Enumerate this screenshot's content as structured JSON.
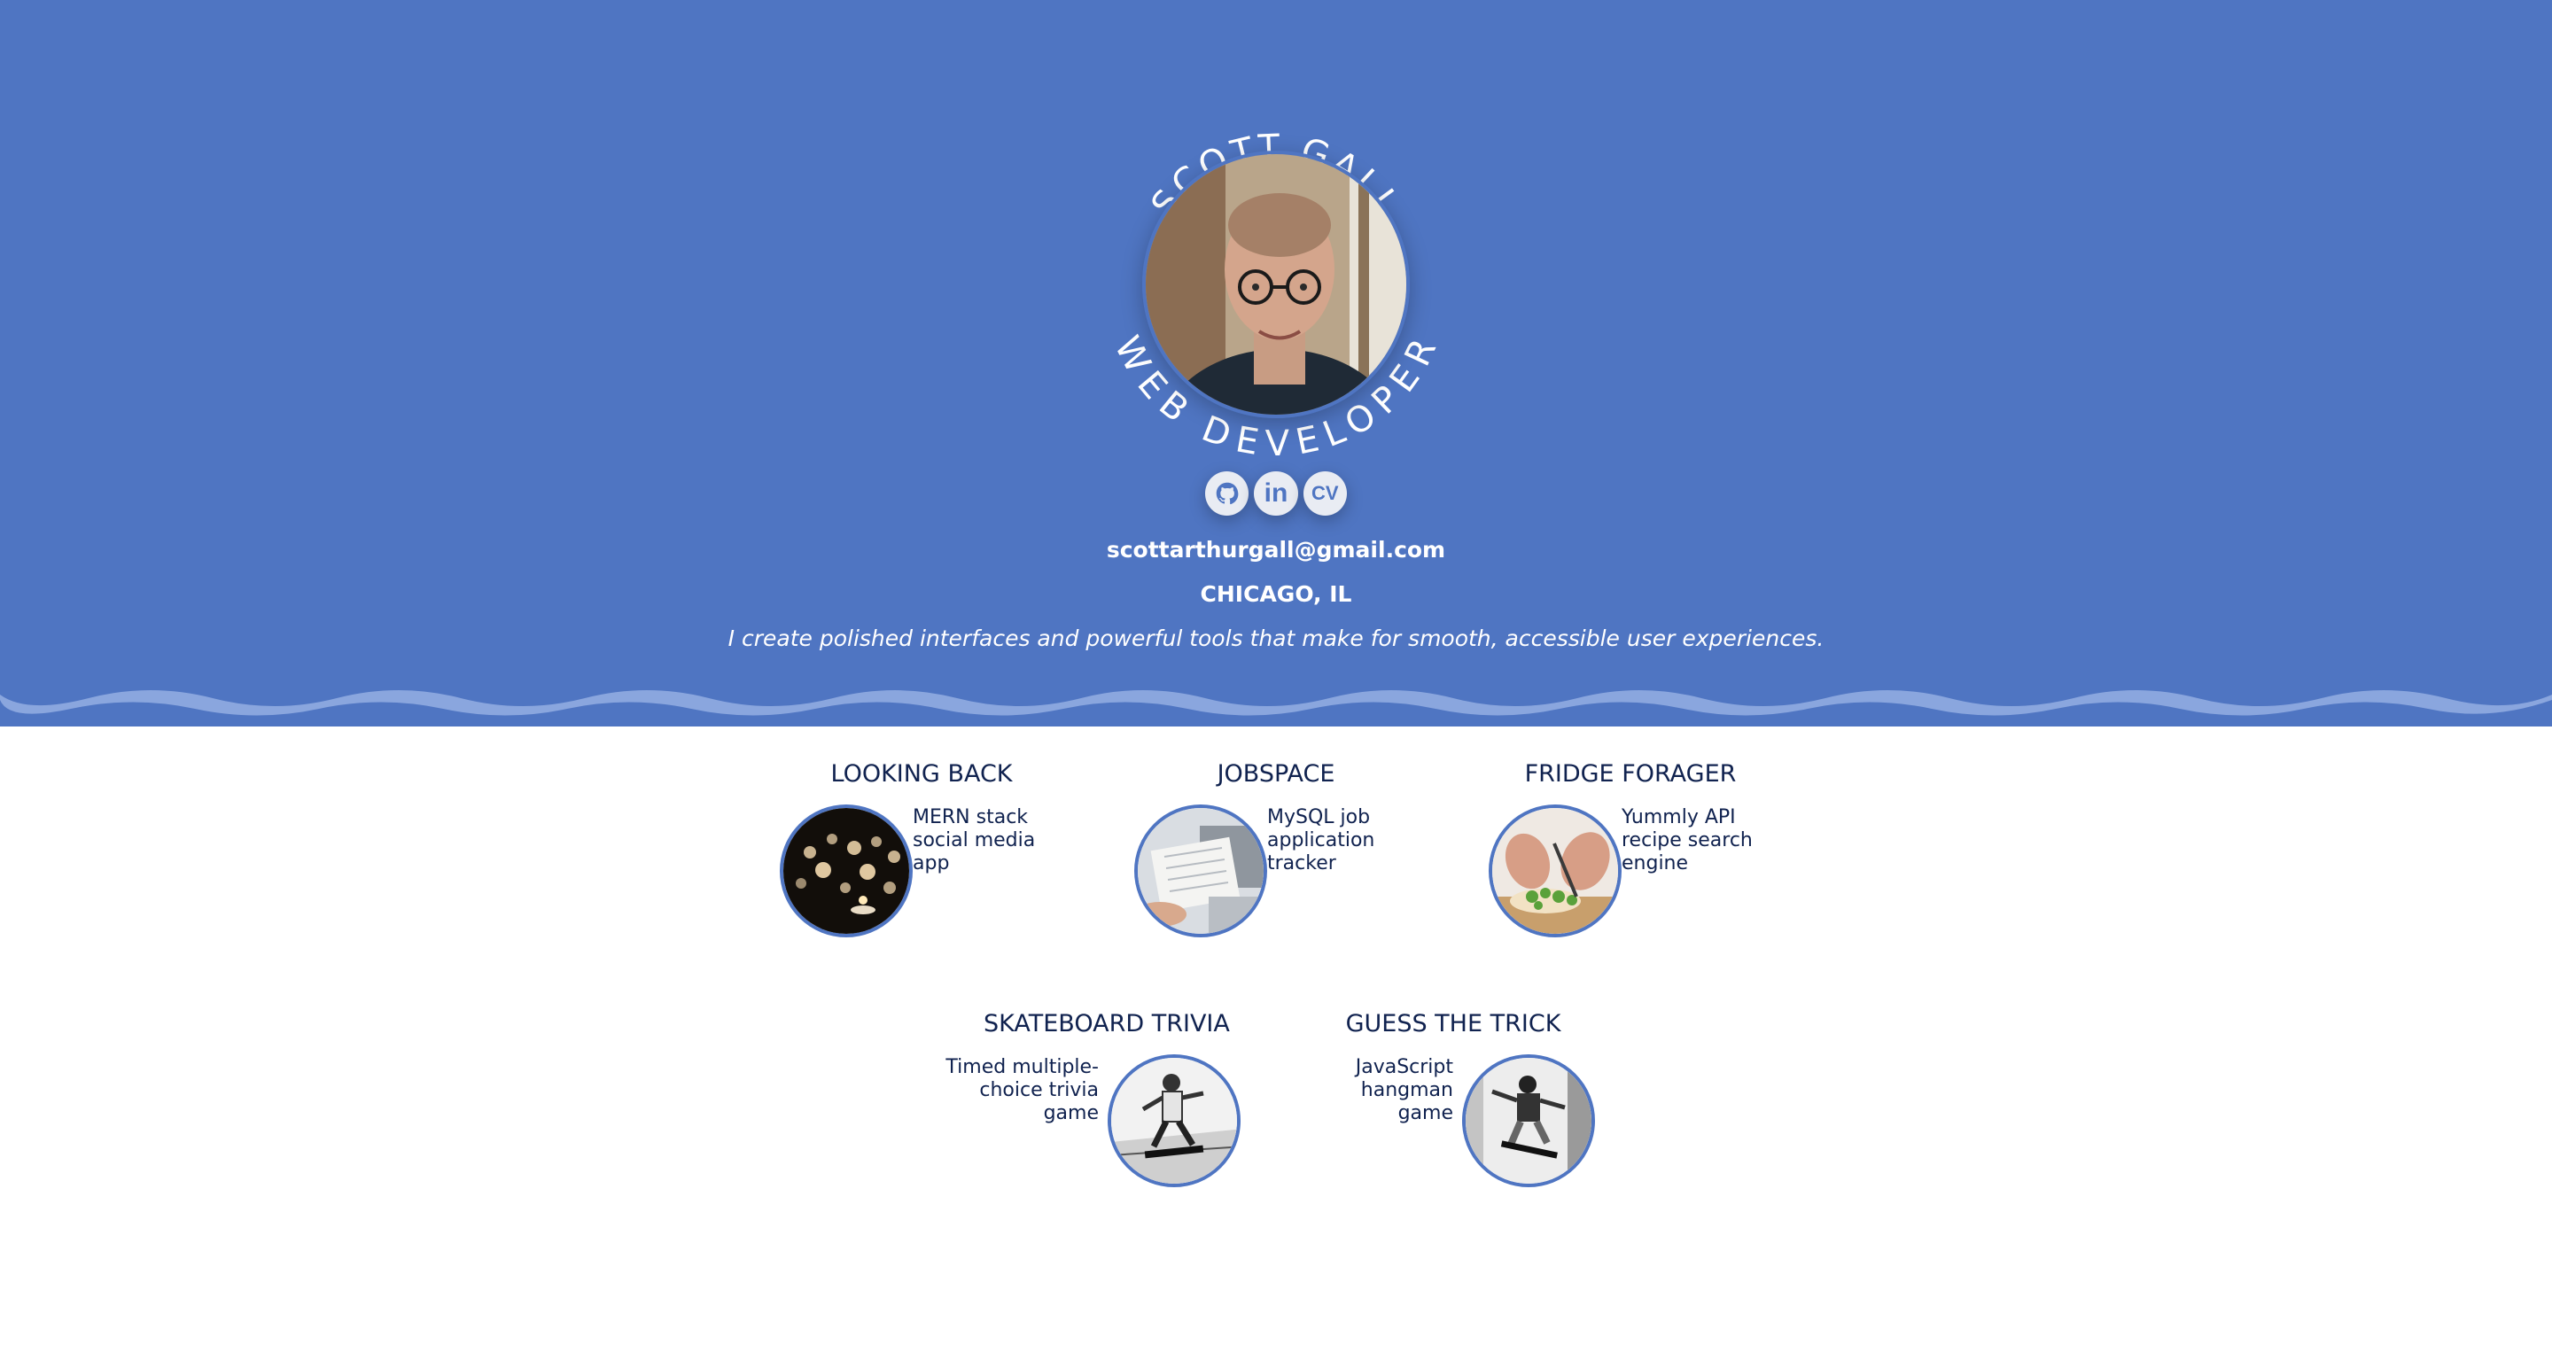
{
  "profile": {
    "name": "SCOTT GALL",
    "title": "WEB DEVELOPER",
    "email": "scottarthurgall@gmail.com",
    "location": "CHICAGO, IL",
    "tagline": "I create polished interfaces and powerful tools that make for smooth, accessible user experiences."
  },
  "social": [
    {
      "icon": "github-icon",
      "label": ""
    },
    {
      "icon": "linkedin-icon",
      "label": "in"
    },
    {
      "icon": "cv-icon",
      "label": "CV"
    }
  ],
  "projects": [
    {
      "title": "LOOKING BACK",
      "description": "MERN stack social media app",
      "image": "candles-image"
    },
    {
      "title": "JOBSPACE",
      "description": "MySQL job application tracker",
      "image": "laptop-documents-image"
    },
    {
      "title": "FRIDGE FORAGER",
      "description": "Yummly API recipe search engine",
      "image": "cooking-image"
    },
    {
      "title": "SKATEBOARD TRIVIA",
      "description": "Timed multiple-choice trivia game",
      "image": "skateboarder-image"
    },
    {
      "title": "GUESS THE TRICK",
      "description": "JavaScript hangman game",
      "image": "skateboard-trick-image"
    }
  ],
  "colors": {
    "hero_background": "#4f75c2",
    "text_dark": "#10224f",
    "accent_border": "#4f75c2"
  }
}
